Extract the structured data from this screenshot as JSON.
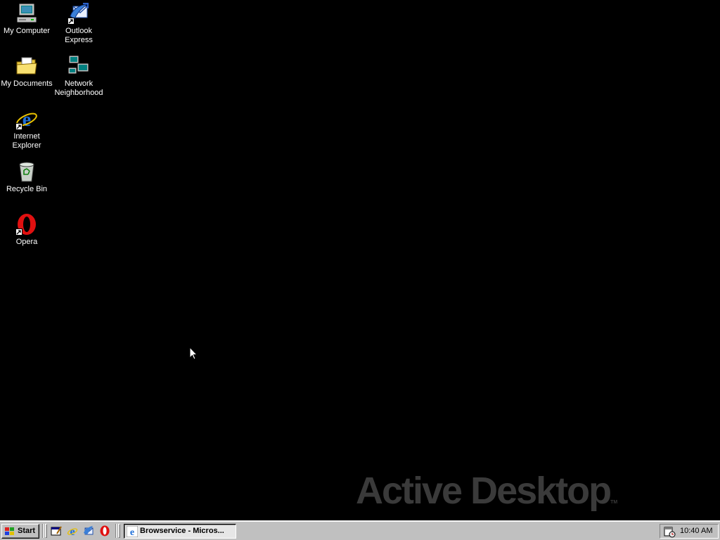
{
  "desktop": {
    "icons": [
      {
        "label": "My Computer"
      },
      {
        "label": "Outlook Express"
      },
      {
        "label": "My Documents"
      },
      {
        "label": "Network Neighborhood"
      },
      {
        "label": "Internet Explorer"
      },
      {
        "label": "Recycle Bin"
      },
      {
        "label": "Opera"
      }
    ],
    "wallpaper_text": "Active Desktop",
    "wallpaper_tm": "TM"
  },
  "taskbar": {
    "start_label": "Start",
    "quick_launch": [
      "show-desktop-icon",
      "internet-explorer-icon",
      "outlook-express-icon",
      "opera-icon"
    ],
    "task_button_label": "Browservice - Micros...",
    "clock": "10:40 AM"
  },
  "colors": {
    "desktop_bg": "#000000",
    "taskbar_bg": "#c0c0c0",
    "wallpaper_text": "#3a3a3a"
  }
}
